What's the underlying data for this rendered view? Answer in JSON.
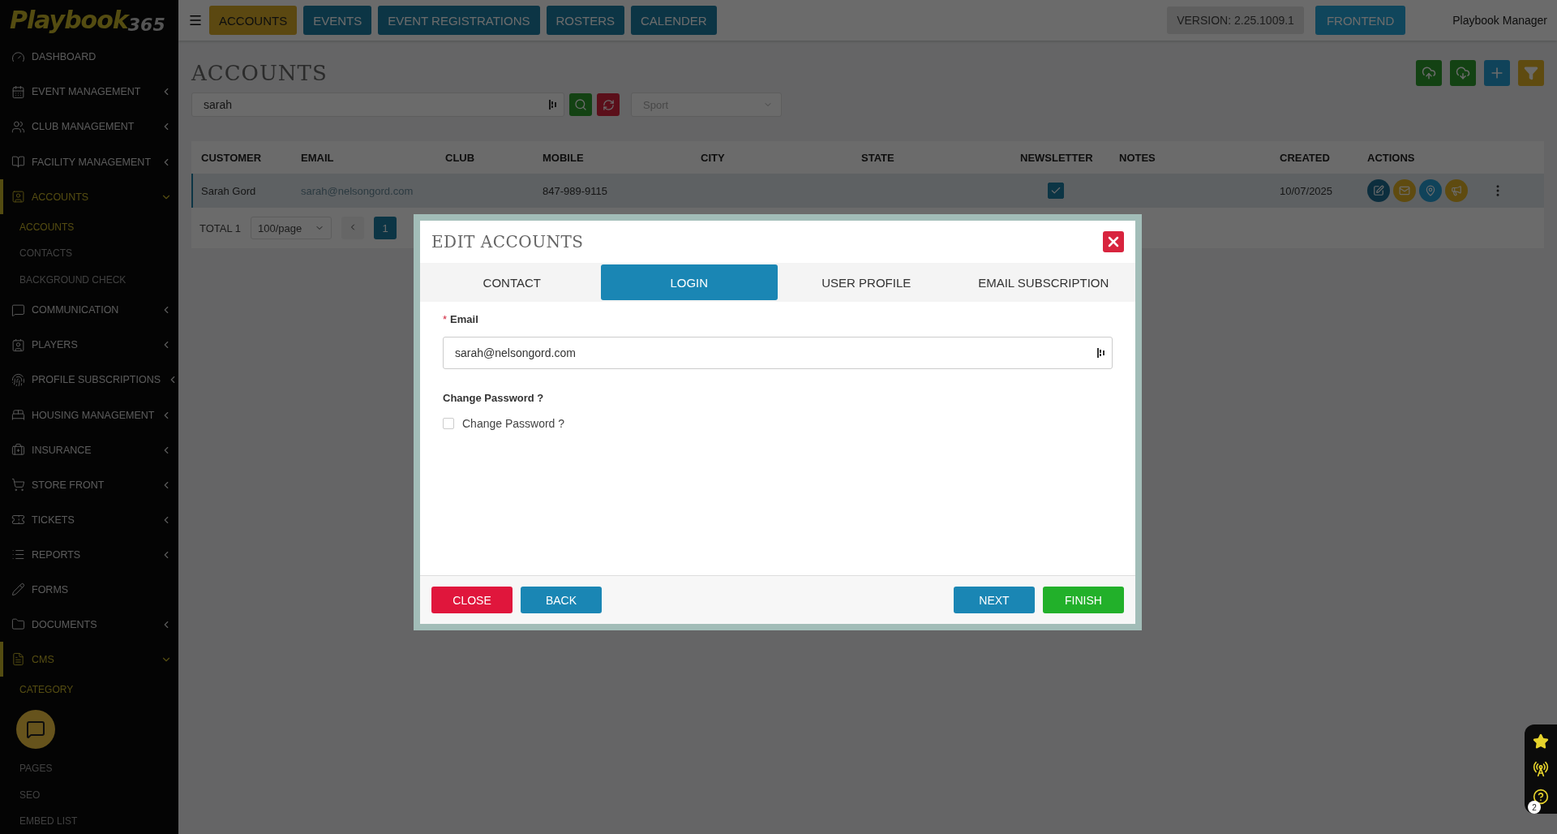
{
  "logo": {
    "name": "Playbook",
    "suffix": "365"
  },
  "topbar": {
    "tabs": [
      {
        "label": "ACCOUNTS",
        "selected": true
      },
      {
        "label": "EVENTS",
        "selected": false
      },
      {
        "label": "EVENT REGISTRATIONS",
        "selected": false
      },
      {
        "label": "ROSTERS",
        "selected": false
      },
      {
        "label": "CALENDER",
        "selected": false
      }
    ],
    "version": "VERSION: 2.25.1009.1",
    "frontend": "FRONTEND",
    "user": "Playbook Manager"
  },
  "sidebar": {
    "items": [
      {
        "label": "DASHBOARD",
        "kind": "link",
        "selected": false
      },
      {
        "label": "EVENT MANAGEMENT",
        "kind": "group",
        "expanded": false,
        "selected": false
      },
      {
        "label": "CLUB MANAGEMENT",
        "kind": "group",
        "expanded": false,
        "selected": false
      },
      {
        "label": "FACILITY MANAGEMENT",
        "kind": "group",
        "expanded": false,
        "selected": false
      },
      {
        "label": "ACCOUNTS",
        "kind": "group",
        "expanded": true,
        "selected": true,
        "children": [
          {
            "label": "ACCOUNTS",
            "selected": true
          },
          {
            "label": "CONTACTS",
            "selected": false
          },
          {
            "label": "BACKGROUND CHECK",
            "selected": false
          }
        ]
      },
      {
        "label": "COMMUNICATION",
        "kind": "group",
        "expanded": false,
        "selected": false
      },
      {
        "label": "PLAYERS",
        "kind": "group",
        "expanded": false,
        "selected": false
      },
      {
        "label": "PROFILE SUBSCRIPTIONS",
        "kind": "group",
        "expanded": false,
        "selected": false
      },
      {
        "label": "HOUSING MANAGEMENT",
        "kind": "group",
        "expanded": false,
        "selected": false
      },
      {
        "label": "INSURANCE",
        "kind": "group",
        "expanded": false,
        "selected": false
      },
      {
        "label": "STORE FRONT",
        "kind": "group",
        "expanded": false,
        "selected": false
      },
      {
        "label": "TICKETS",
        "kind": "group",
        "expanded": false,
        "selected": false
      },
      {
        "label": "REPORTS",
        "kind": "group",
        "expanded": false,
        "selected": false
      },
      {
        "label": "FORMS",
        "kind": "link",
        "selected": false
      },
      {
        "label": "DOCUMENTS",
        "kind": "group",
        "expanded": false,
        "selected": false
      },
      {
        "label": "CMS",
        "kind": "group",
        "expanded": true,
        "selected": true,
        "children": [
          {
            "label": "CATEGORY",
            "selected": true
          },
          {
            "label": "PAGES",
            "selected": false
          },
          {
            "label": "SEO",
            "selected": false
          },
          {
            "label": "EMBED LIST",
            "selected": false
          }
        ]
      }
    ]
  },
  "page": {
    "title": "ACCOUNTS",
    "search": {
      "value": "sarah"
    },
    "sport": {
      "placeholder": "Sport"
    }
  },
  "table": {
    "columns": [
      "CUSTOMER",
      "EMAIL",
      "CLUB",
      "MOBILE",
      "CITY",
      "STATE",
      "NEWSLETTER",
      "NOTES",
      "CREATED",
      "ACTIONS"
    ],
    "rows": [
      {
        "customer": "Sarah Gord",
        "email": "sarah@nelsongord.com",
        "mobile": "847-989-9115",
        "newsletter": true,
        "created": "10/07/2025",
        "selected": true
      }
    ]
  },
  "pagination": {
    "total": "TOTAL 1",
    "page_size": "100/page",
    "pages": [
      {
        "label": "1",
        "selected": true
      }
    ]
  },
  "modal": {
    "title": "EDIT ACCOUNTS",
    "tabs": [
      {
        "label": "CONTACT",
        "selected": false
      },
      {
        "label": "LOGIN",
        "selected": true
      },
      {
        "label": "USER PROFILE",
        "selected": false
      },
      {
        "label": "EMAIL SUBSCRIPTION",
        "selected": false
      }
    ],
    "email_label": "Email",
    "required": "*",
    "email": {
      "value": "sarah@nelsongord.com"
    },
    "change_password_heading": "Change Password ?",
    "change_password": {
      "label": "Change Password ?",
      "checked": false
    },
    "buttons": {
      "close": "CLOSE",
      "back": "BACK",
      "next": "NEXT",
      "finish": "FINISH"
    }
  },
  "help_widget": {
    "badge": "2"
  }
}
